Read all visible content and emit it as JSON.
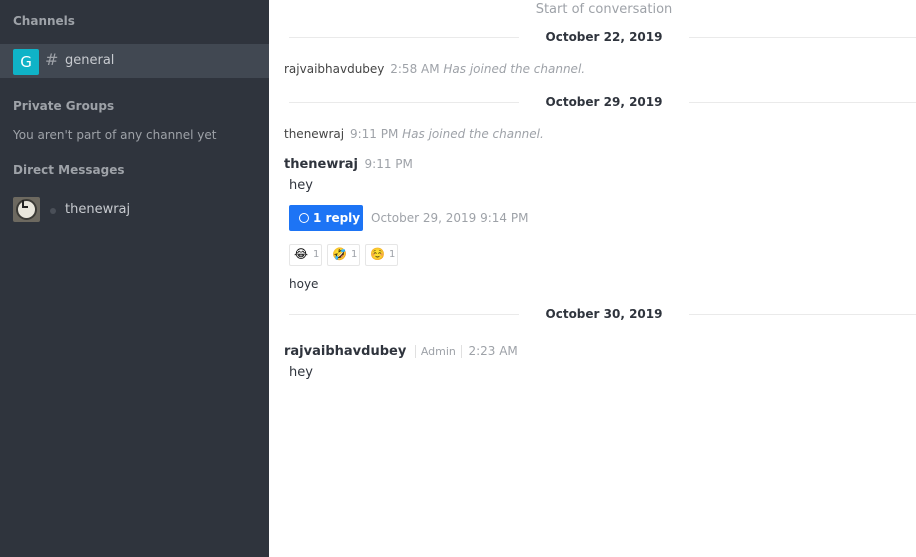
{
  "sidebar": {
    "channels_title": "Channels",
    "channels": [
      {
        "avatar_letter": "G",
        "name": "general"
      }
    ],
    "private_title": "Private Groups",
    "private_empty": "You aren't part of any channel yet",
    "dm_title": "Direct Messages",
    "dms": [
      {
        "name": "thenewraj"
      }
    ]
  },
  "main": {
    "start_label": "Start of conversation",
    "dates": [
      "October 22, 2019",
      "October 29, 2019",
      "October 30, 2019"
    ],
    "sys1": {
      "user": "rajvaibhavdubey",
      "time": "2:58 AM",
      "action": "Has joined the channel."
    },
    "sys2": {
      "user": "thenewraj",
      "time": "9:11 PM",
      "action": "Has joined the channel."
    },
    "msg1": {
      "user": "thenewraj",
      "time": "9:11 PM",
      "text": "hey"
    },
    "thread": {
      "reply_label": "1 reply",
      "timestamp": "October 29, 2019 9:14 PM"
    },
    "reactions": [
      {
        "emoji": "😂",
        "count": "1"
      },
      {
        "emoji": "🤣",
        "count": "1"
      },
      {
        "emoji": "☺️",
        "count": "1"
      }
    ],
    "msg1b_text": "hoye",
    "msg2": {
      "user": "rajvaibhavdubey",
      "role": "Admin",
      "time": "2:23 AM",
      "text": "hey"
    }
  },
  "colors": {
    "sidebar_bg": "#2f343d",
    "selected_item": "#414852",
    "accent": "#1d74f5",
    "channel_avatar": "#0fb3c7"
  }
}
